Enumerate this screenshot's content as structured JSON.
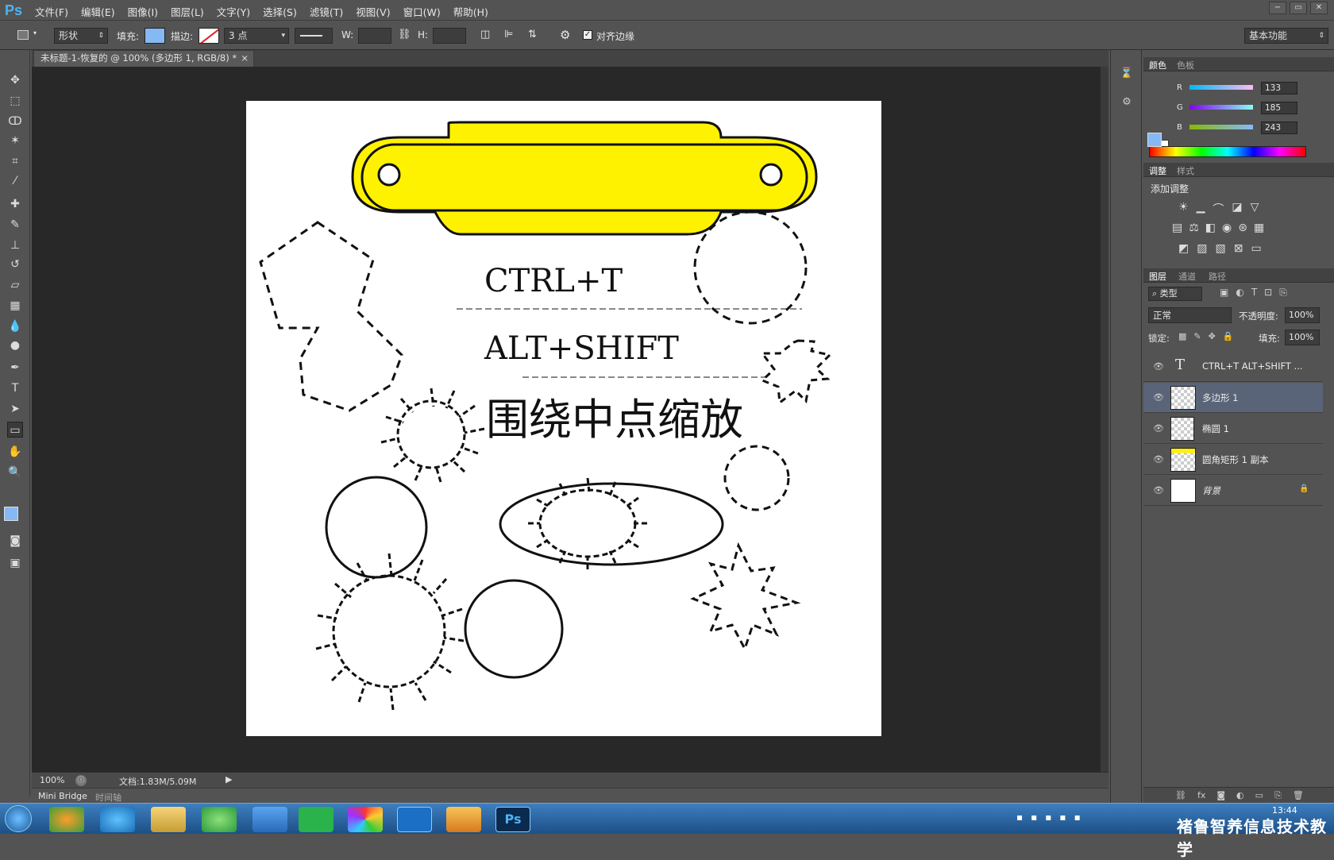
{
  "app": {
    "logo": "Ps"
  },
  "menu": [
    "文件(F)",
    "编辑(E)",
    "图像(I)",
    "图层(L)",
    "文字(Y)",
    "选择(S)",
    "滤镜(T)",
    "视图(V)",
    "窗口(W)",
    "帮助(H)"
  ],
  "window_buttons": [
    "−",
    "▭",
    "✕"
  ],
  "options": {
    "mode": "形状",
    "fill_label": "填充:",
    "stroke_label": "描边:",
    "stroke_size": "3 点",
    "w_label": "W:",
    "h_label": "H:",
    "align_edges": "对齐边缘",
    "workspace": "基本功能",
    "fill_color": "#85b9f3"
  },
  "document": {
    "tab_title": "未标题-1-恢复的 @ 100% (多边形 1, RGB/8) *",
    "close": "×"
  },
  "canvas_text": {
    "line1": "CTRL+T",
    "line2": "ALT+SHIFT",
    "line3": "围绕中点缩放"
  },
  "status": {
    "zoom": "100%",
    "doc": "文档:1.83M/5.09M"
  },
  "bottom_tabs": [
    "Mini Bridge",
    "时间轴"
  ],
  "color_panel": {
    "tabs": [
      "颜色",
      "色板"
    ],
    "r_label": "R",
    "g_label": "G",
    "b_label": "B",
    "r": "133",
    "g": "185",
    "b": "243",
    "foreground": "#85b9f3"
  },
  "adjustments_panel": {
    "tabs": [
      "调整",
      "样式"
    ],
    "title": "添加调整"
  },
  "layers_panel": {
    "tabs": [
      "图层",
      "通道",
      "路径"
    ],
    "filter": "类型",
    "blend_mode": "正常",
    "opacity_label": "不透明度:",
    "opacity": "100%",
    "lock_label": "锁定:",
    "fill_label": "填充:",
    "fill": "100%",
    "layers": [
      {
        "name": "CTRL+T  ALT+SHIFT ...",
        "kind": "text"
      },
      {
        "name": "多边形 1",
        "kind": "shape",
        "selected": true
      },
      {
        "name": "椭圆 1",
        "kind": "shape"
      },
      {
        "name": "圆角矩形 1 副本",
        "kind": "shape"
      },
      {
        "name": "背景",
        "kind": "background"
      }
    ]
  },
  "taskbar": {
    "clock": "13:44",
    "watermark": "褚鲁智养信息技术教学"
  }
}
